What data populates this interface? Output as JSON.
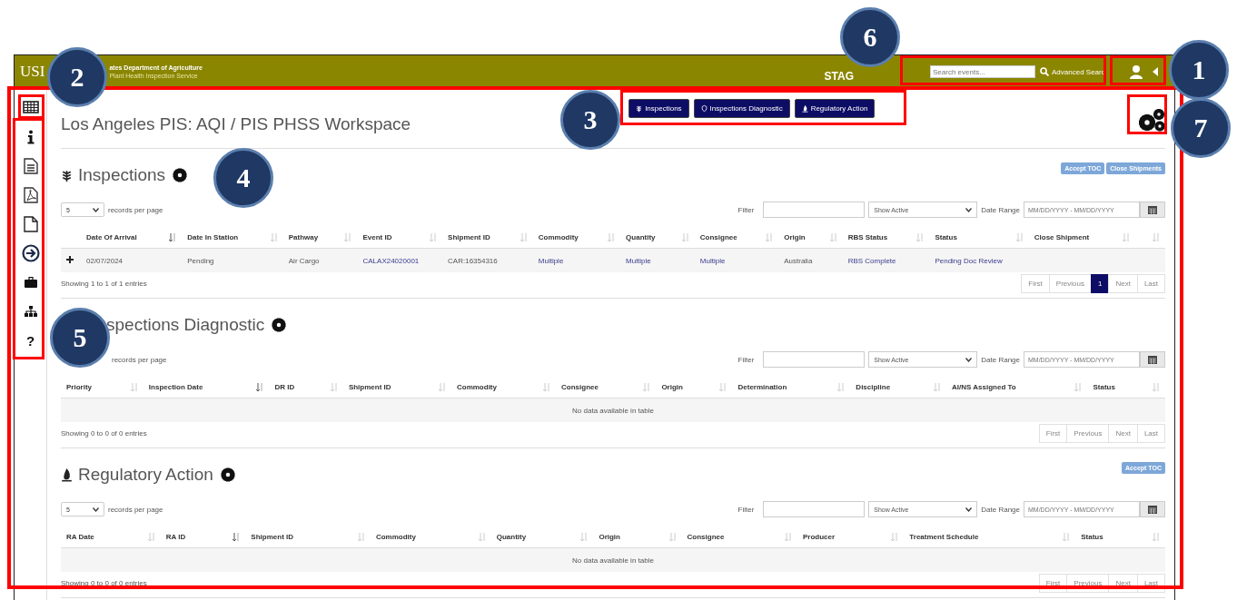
{
  "header": {
    "logo_text": "USI",
    "agency": "ates Department of Agriculture",
    "subagency": "Plant Health Inspection Service",
    "environment": "STAG",
    "search": {
      "placeholder": "Search events..."
    },
    "advanced_search": "Advanced Searc"
  },
  "sidebar": [
    {
      "kind": "table"
    },
    {
      "kind": "info"
    },
    {
      "kind": "document"
    },
    {
      "kind": "pdf"
    },
    {
      "kind": "file"
    },
    {
      "kind": "arrow"
    },
    {
      "kind": "briefcase"
    },
    {
      "kind": "sitemap"
    },
    {
      "kind": "help",
      "glyph": "?"
    }
  ],
  "workspace_title": "Los Angeles PIS: AQI / PIS PHSS Workspace",
  "nav_buttons": [
    {
      "label": "Inspections",
      "kind": "plant"
    },
    {
      "label": "Inspections Diagnostic",
      "kind": "shield"
    },
    {
      "label": "Regulatory Action",
      "kind": "flame"
    }
  ],
  "sections": [
    {
      "title": "Inspections",
      "kind": "plant",
      "actions": [
        "Accept TOC",
        "Close Shipments"
      ],
      "records_per_page": "5",
      "records_label": "records per page",
      "filter_label": "Filter",
      "show_select": "Show Active",
      "date_range_label": "Date Range",
      "date_placeholder": "MM/DD/YYYY - MM/DD/YYYY",
      "columns": [
        {
          "label": "Date Of Arrival",
          "sorted": true
        },
        {
          "label": "Date In Station",
          "sorted": false
        },
        {
          "label": "Pathway",
          "sorted": false
        },
        {
          "label": "Event ID",
          "sorted": false
        },
        {
          "label": "Shipment ID",
          "sorted": false
        },
        {
          "label": "Commodity",
          "sorted": false
        },
        {
          "label": "Quantity",
          "sorted": false
        },
        {
          "label": "Consignee",
          "sorted": false
        },
        {
          "label": "Origin",
          "sorted": false
        },
        {
          "label": "RBS Status",
          "sorted": false
        },
        {
          "label": "Status",
          "sorted": false
        },
        {
          "label": "Close Shipment",
          "sorted": false
        },
        {
          "sorted": false
        }
      ],
      "rows": [
        {
          "expandable": true,
          "cells": [
            {
              "text": "02/07/2024",
              "link": false
            },
            {
              "text": "Pending",
              "link": false
            },
            {
              "text": "Air Cargo",
              "link": false
            },
            {
              "text": "CALAX24020001",
              "link": true
            },
            {
              "text": "CAR:16354316",
              "link": false
            },
            {
              "text": "Multiple",
              "link": true
            },
            {
              "text": "Multiple",
              "link": true
            },
            {
              "text": "Multiple",
              "link": true
            },
            {
              "text": "Australia",
              "link": false
            },
            {
              "text": "RBS Complete",
              "link": true
            },
            {
              "text": "Pending Doc Review",
              "link": true
            }
          ]
        }
      ],
      "info": "Showing 1 to 1 of 1 entries",
      "pagination": [
        {
          "label": "First",
          "selected": false
        },
        {
          "label": "Previous",
          "selected": false
        },
        {
          "label": "1",
          "selected": true
        },
        {
          "label": "Next",
          "selected": false
        },
        {
          "label": "Last",
          "selected": false
        }
      ]
    },
    {
      "title": "spections Diagnostic",
      "records_label": "records per page",
      "filter_label": "Filter",
      "show_select": "Show Active",
      "date_range_label": "Date Range",
      "date_placeholder": "MM/DD/YYYY - MM/DD/YYYY",
      "columns": [
        {
          "label": "Priority",
          "sorted": false
        },
        {
          "label": "Inspection Date",
          "sorted": true
        },
        {
          "label": "DR ID",
          "sorted": false
        },
        {
          "label": "Shipment ID",
          "sorted": false
        },
        {
          "label": "Commodity",
          "sorted": false
        },
        {
          "label": "Consignee",
          "sorted": false
        },
        {
          "label": "Origin",
          "sorted": false
        },
        {
          "label": "Determination",
          "sorted": false
        },
        {
          "label": "Discipline",
          "sorted": false
        },
        {
          "label": "AI/NS Assigned To",
          "sorted": false
        },
        {
          "label": "Status",
          "sorted": false
        }
      ],
      "empty_message": "No data available in table",
      "info": "Showing 0 to 0 of 0 entries",
      "pagination": [
        {
          "label": "First",
          "selected": false
        },
        {
          "label": "Previous",
          "selected": false
        },
        {
          "label": "Next",
          "selected": false
        },
        {
          "label": "Last",
          "selected": false
        }
      ]
    },
    {
      "title": "Regulatory Action",
      "kind": "flame",
      "actions": [
        "Accept TOC"
      ],
      "records_per_page": "5",
      "records_label": "records per page",
      "filter_label": "Filter",
      "show_select": "Show Active",
      "date_range_label": "Date Range",
      "date_placeholder": "MM/DD/YYYY - MM/DD/YYYY",
      "columns": [
        {
          "label": "RA Date",
          "sorted": false
        },
        {
          "label": "RA ID",
          "sorted": true
        },
        {
          "label": "Shipment ID",
          "sorted": false
        },
        {
          "label": "Commodity",
          "sorted": false
        },
        {
          "label": "Quantity",
          "sorted": false
        },
        {
          "label": "Origin",
          "sorted": false
        },
        {
          "label": "Consignee",
          "sorted": false
        },
        {
          "label": "Producer",
          "sorted": false
        },
        {
          "label": "Treatment Schedule",
          "sorted": false
        },
        {
          "label": "Status",
          "sorted": false
        }
      ],
      "empty_message": "No data available in table",
      "info": "Showing 0 to 0 of 0 entries",
      "pagination": [
        {
          "label": "First",
          "selected": false
        },
        {
          "label": "Previous",
          "selected": false
        },
        {
          "label": "Next",
          "selected": false
        },
        {
          "label": "Last",
          "selected": false
        }
      ]
    }
  ],
  "callouts": [
    {
      "number": "1"
    },
    {
      "number": "2"
    },
    {
      "number": "3"
    },
    {
      "number": "4"
    },
    {
      "number": "5"
    },
    {
      "number": "6"
    },
    {
      "number": "7"
    }
  ]
}
